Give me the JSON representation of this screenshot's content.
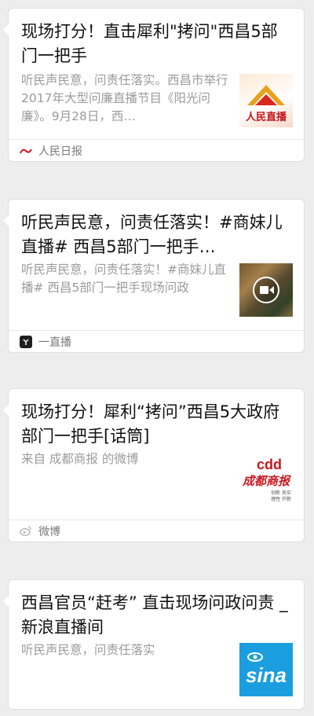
{
  "cards": [
    {
      "title": "现场打分！直击犀利\"拷问\"西昌5部门一把手",
      "description": "听民声民意，问责任落实。西昌市举行2017年大型问廉直播节目《阳光问廉》。9月28日，西…",
      "thumb_text": "人民直播",
      "source": "人民日报"
    },
    {
      "title": "听民声民意，问责任落实！#商妹儿直播# 西昌5部门一把手…",
      "description": "听民声民意，问责任落实！#商妹儿直播# 西昌5部门一把手现场问政",
      "source": "一直播"
    },
    {
      "title": "现场打分！犀利“拷问”西昌5大政府部门一把手[话筒]",
      "description": "来自 成都商报 的微博",
      "thumb_text": "成都商报",
      "thumb_tags": [
        "创新 务实",
        "理性 开新"
      ],
      "source": "微博"
    },
    {
      "title": "西昌官员“赶考” 直击现场问政问责 _ 新浪直播间",
      "description": "听民声民意，问责任落实",
      "thumb_text": "sina"
    }
  ],
  "colors": {
    "background": "#ededed",
    "card": "#ffffff",
    "title": "#111111",
    "description": "#9b9b9b",
    "sina_blue": "#1a9ee0",
    "chengdu_red": "#c8161d"
  }
}
